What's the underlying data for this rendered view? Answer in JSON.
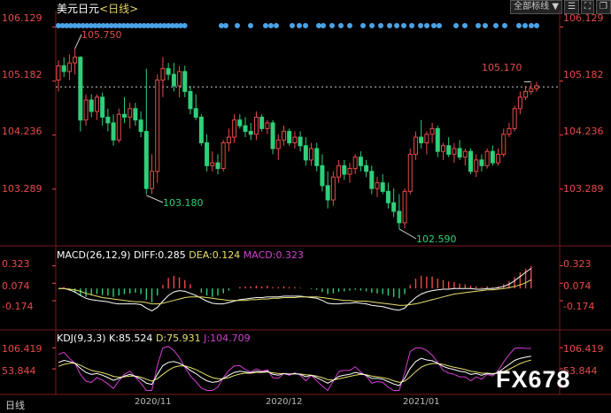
{
  "window": {
    "title": "美元日元",
    "period": "<日线>",
    "watermark": "FX678",
    "period_label": "日线"
  },
  "toolbar": {
    "all_label": "全部标线",
    "dropdown_icon": "triangle-down-icon",
    "icons": [
      "list-icon",
      "fullscreen-icon",
      "restore-icon"
    ]
  },
  "colors": {
    "up": "#e84a4a",
    "down": "#2ed07a",
    "dot": "#4aa3e8",
    "macd_diff": "#ffffff",
    "macd_dea": "#e8e06b",
    "kdj_k": "#ffffff",
    "kdj_d": "#e8e06b",
    "kdj_j": "#d43fd4"
  },
  "chart_data": [
    {
      "type": "candlestick",
      "title": "美元日元<日线>",
      "y_ticks": [
        "106.129",
        "105.182",
        "104.236",
        "103.289"
      ],
      "ylim": [
        102.45,
        106.2
      ],
      "x_ticks": [
        "2020/11",
        "2020/12",
        "2021/01"
      ],
      "annotations": [
        {
          "label": "105.750",
          "value": 105.75,
          "kind": "high"
        },
        {
          "label": "103.180",
          "value": 103.18,
          "kind": "low"
        },
        {
          "label": "102.590",
          "value": 102.59,
          "kind": "low"
        },
        {
          "label": "105.170",
          "value": 105.17,
          "kind": "high"
        }
      ],
      "last_price": 105.08,
      "ohlc": [
        [
          105.2,
          105.55,
          105.0,
          105.45
        ],
        [
          105.45,
          105.6,
          105.25,
          105.35
        ],
        [
          105.35,
          105.65,
          105.2,
          105.5
        ],
        [
          105.5,
          105.75,
          105.3,
          105.6
        ],
        [
          105.6,
          105.62,
          104.3,
          104.5
        ],
        [
          104.5,
          104.95,
          104.4,
          104.85
        ],
        [
          104.85,
          104.95,
          104.55,
          104.65
        ],
        [
          104.65,
          104.95,
          104.5,
          104.9
        ],
        [
          104.9,
          104.98,
          104.4,
          104.55
        ],
        [
          104.55,
          104.7,
          104.3,
          104.45
        ],
        [
          104.45,
          104.6,
          104.05,
          104.15
        ],
        [
          104.15,
          104.7,
          104.1,
          104.6
        ],
        [
          104.6,
          104.9,
          104.45,
          104.55
        ],
        [
          104.55,
          104.8,
          104.35,
          104.7
        ],
        [
          104.7,
          104.8,
          104.4,
          104.5
        ],
        [
          104.5,
          104.65,
          104.2,
          104.3
        ],
        [
          104.3,
          105.4,
          103.2,
          103.3
        ],
        [
          103.3,
          103.9,
          103.2,
          103.6
        ],
        [
          103.6,
          105.3,
          103.4,
          105.2
        ],
        [
          105.2,
          105.6,
          104.9,
          105.4
        ],
        [
          105.4,
          105.5,
          105.2,
          105.3
        ],
        [
          105.3,
          105.5,
          105.0,
          105.1
        ],
        [
          105.1,
          105.45,
          104.9,
          105.35
        ],
        [
          105.35,
          105.45,
          104.9,
          105.0
        ],
        [
          105.0,
          105.1,
          104.6,
          104.7
        ],
        [
          104.7,
          104.95,
          104.5,
          104.55
        ],
        [
          104.55,
          104.6,
          104.05,
          104.1
        ],
        [
          104.1,
          104.25,
          103.6,
          103.7
        ],
        [
          103.7,
          103.95,
          103.6,
          103.75
        ],
        [
          103.75,
          103.9,
          103.55,
          103.65
        ],
        [
          103.65,
          104.15,
          103.6,
          104.1
        ],
        [
          104.1,
          104.35,
          103.95,
          104.2
        ],
        [
          104.2,
          104.6,
          104.1,
          104.5
        ],
        [
          104.5,
          104.6,
          104.35,
          104.4
        ],
        [
          104.4,
          104.55,
          104.2,
          104.3
        ],
        [
          104.3,
          104.45,
          104.15,
          104.25
        ],
        [
          104.25,
          104.65,
          104.15,
          104.55
        ],
        [
          104.55,
          104.6,
          104.3,
          104.35
        ],
        [
          104.35,
          104.5,
          104.25,
          104.45
        ],
        [
          104.45,
          104.5,
          103.9,
          104.0
        ],
        [
          104.0,
          104.25,
          103.8,
          104.15
        ],
        [
          104.15,
          104.4,
          104.05,
          104.3
        ],
        [
          104.3,
          104.35,
          104.05,
          104.1
        ],
        [
          104.1,
          104.3,
          104.0,
          104.2
        ],
        [
          104.2,
          104.3,
          103.95,
          104.05
        ],
        [
          104.05,
          104.2,
          103.7,
          103.8
        ],
        [
          103.8,
          104.1,
          103.7,
          104.0
        ],
        [
          104.0,
          104.1,
          103.6,
          103.7
        ],
        [
          103.7,
          103.9,
          103.25,
          103.35
        ],
        [
          103.35,
          103.6,
          102.95,
          103.1
        ],
        [
          103.1,
          103.6,
          103.0,
          103.5
        ],
        [
          103.5,
          103.8,
          103.4,
          103.7
        ],
        [
          103.7,
          103.8,
          103.45,
          103.55
        ],
        [
          103.55,
          103.75,
          103.4,
          103.65
        ],
        [
          103.65,
          103.9,
          103.55,
          103.85
        ],
        [
          103.85,
          103.95,
          103.6,
          103.7
        ],
        [
          103.7,
          103.8,
          103.5,
          103.6
        ],
        [
          103.6,
          103.7,
          103.2,
          103.3
        ],
        [
          103.3,
          103.5,
          103.15,
          103.4
        ],
        [
          103.4,
          103.55,
          103.2,
          103.25
        ],
        [
          103.25,
          103.4,
          102.95,
          103.05
        ],
        [
          103.05,
          103.3,
          102.8,
          102.9
        ],
        [
          102.9,
          103.2,
          102.59,
          102.7
        ],
        [
          102.7,
          103.3,
          102.6,
          103.25
        ],
        [
          103.25,
          104.0,
          103.2,
          103.9
        ],
        [
          103.9,
          104.3,
          103.8,
          104.2
        ],
        [
          104.2,
          104.5,
          104.0,
          104.1
        ],
        [
          104.1,
          104.3,
          103.9,
          104.25
        ],
        [
          104.25,
          104.45,
          104.1,
          104.35
        ],
        [
          104.35,
          104.4,
          103.85,
          103.95
        ],
        [
          103.95,
          104.1,
          103.8,
          104.05
        ],
        [
          104.05,
          104.2,
          103.85,
          103.9
        ],
        [
          103.9,
          104.1,
          103.75,
          104.0
        ],
        [
          104.0,
          104.15,
          103.8,
          103.85
        ],
        [
          103.85,
          104.0,
          103.7,
          103.95
        ],
        [
          103.95,
          104.0,
          103.55,
          103.6
        ],
        [
          103.6,
          103.9,
          103.5,
          103.8
        ],
        [
          103.8,
          103.9,
          103.6,
          103.7
        ],
        [
          103.7,
          104.0,
          103.65,
          103.95
        ],
        [
          103.95,
          104.05,
          103.7,
          103.75
        ],
        [
          103.75,
          104.0,
          103.7,
          103.9
        ],
        [
          103.9,
          104.35,
          103.85,
          104.25
        ],
        [
          104.25,
          104.45,
          104.2,
          104.35
        ],
        [
          104.35,
          104.75,
          104.3,
          104.7
        ],
        [
          104.7,
          105.0,
          104.6,
          104.9
        ],
        [
          104.9,
          105.1,
          104.85,
          105.0
        ],
        [
          105.0,
          105.15,
          104.95,
          105.05
        ],
        [
          105.05,
          105.17,
          105.0,
          105.1
        ]
      ]
    },
    {
      "type": "bar",
      "title": "MACD(26,12,9)",
      "legend": [
        {
          "name": "DIFF",
          "value": "0.285"
        },
        {
          "name": "DEA",
          "value": "0.124"
        },
        {
          "name": "MACD",
          "value": "0.323"
        }
      ],
      "y_ticks": [
        "0.323",
        "0.074",
        "-0.174"
      ],
      "ylim": [
        -0.3,
        0.38
      ],
      "series_note": "histogram = MACD",
      "histogram": [
        0.0,
        0.02,
        -0.03,
        -0.06,
        -0.1,
        -0.12,
        -0.1,
        -0.08,
        -0.09,
        -0.1,
        -0.12,
        -0.1,
        -0.08,
        -0.07,
        -0.06,
        -0.08,
        -0.16,
        -0.2,
        -0.1,
        0.05,
        0.15,
        0.18,
        0.16,
        0.12,
        0.06,
        0.0,
        -0.06,
        -0.1,
        -0.12,
        -0.1,
        -0.07,
        -0.03,
        0.0,
        0.02,
        0.03,
        0.03,
        0.04,
        0.03,
        0.04,
        0.02,
        0.02,
        0.03,
        0.02,
        0.02,
        0.01,
        0.0,
        -0.01,
        -0.02,
        -0.05,
        -0.08,
        -0.07,
        -0.05,
        -0.04,
        -0.03,
        -0.02,
        -0.03,
        -0.04,
        -0.06,
        -0.07,
        -0.08,
        -0.1,
        -0.12,
        -0.14,
        -0.08,
        0.05,
        0.14,
        0.18,
        0.17,
        0.17,
        0.14,
        0.12,
        0.1,
        0.09,
        0.07,
        0.06,
        0.04,
        0.03,
        0.02,
        0.03,
        0.02,
        0.03,
        0.06,
        0.1,
        0.16,
        0.23,
        0.28,
        0.32
      ],
      "diff": [
        0.0,
        0.0,
        -0.02,
        -0.05,
        -0.1,
        -0.14,
        -0.16,
        -0.17,
        -0.18,
        -0.19,
        -0.21,
        -0.22,
        -0.22,
        -0.22,
        -0.22,
        -0.23,
        -0.28,
        -0.32,
        -0.27,
        -0.18,
        -0.1,
        -0.05,
        -0.03,
        -0.04,
        -0.07,
        -0.1,
        -0.14,
        -0.18,
        -0.21,
        -0.22,
        -0.22,
        -0.2,
        -0.18,
        -0.16,
        -0.15,
        -0.14,
        -0.13,
        -0.13,
        -0.12,
        -0.12,
        -0.12,
        -0.11,
        -0.11,
        -0.11,
        -0.11,
        -0.12,
        -0.13,
        -0.14,
        -0.17,
        -0.21,
        -0.22,
        -0.22,
        -0.21,
        -0.21,
        -0.2,
        -0.21,
        -0.22,
        -0.24,
        -0.25,
        -0.26,
        -0.28,
        -0.3,
        -0.31,
        -0.28,
        -0.2,
        -0.13,
        -0.08,
        -0.05,
        -0.03,
        -0.02,
        -0.01,
        -0.01,
        0.0,
        0.0,
        0.0,
        0.0,
        -0.01,
        -0.01,
        0.0,
        0.0,
        0.01,
        0.03,
        0.06,
        0.11,
        0.17,
        0.23,
        0.285
      ],
      "dea": [
        0.0,
        0.0,
        -0.01,
        -0.02,
        -0.04,
        -0.07,
        -0.09,
        -0.11,
        -0.13,
        -0.14,
        -0.15,
        -0.16,
        -0.17,
        -0.18,
        -0.19,
        -0.19,
        -0.2,
        -0.22,
        -0.22,
        -0.21,
        -0.19,
        -0.17,
        -0.15,
        -0.13,
        -0.12,
        -0.12,
        -0.12,
        -0.13,
        -0.14,
        -0.15,
        -0.16,
        -0.17,
        -0.17,
        -0.17,
        -0.17,
        -0.16,
        -0.16,
        -0.15,
        -0.15,
        -0.14,
        -0.14,
        -0.13,
        -0.13,
        -0.13,
        -0.12,
        -0.12,
        -0.12,
        -0.12,
        -0.13,
        -0.14,
        -0.15,
        -0.16,
        -0.17,
        -0.17,
        -0.18,
        -0.18,
        -0.18,
        -0.19,
        -0.2,
        -0.21,
        -0.22,
        -0.23,
        -0.24,
        -0.24,
        -0.23,
        -0.22,
        -0.2,
        -0.18,
        -0.16,
        -0.14,
        -0.12,
        -0.1,
        -0.08,
        -0.07,
        -0.06,
        -0.05,
        -0.04,
        -0.03,
        -0.02,
        -0.02,
        -0.01,
        0.0,
        0.01,
        0.03,
        0.05,
        0.08,
        0.124
      ]
    },
    {
      "type": "line",
      "title": "KDJ(9,3,3)",
      "legend": [
        {
          "name": "K",
          "value": "85.524"
        },
        {
          "name": "D",
          "value": "75.931"
        },
        {
          "name": "J",
          "value": "104.709"
        }
      ],
      "y_ticks": [
        "106.419",
        "53.844"
      ],
      "ylim": [
        -10,
        118
      ],
      "k": [
        70,
        75,
        72,
        68,
        55,
        45,
        40,
        42,
        38,
        32,
        25,
        30,
        36,
        40,
        35,
        28,
        18,
        15,
        40,
        62,
        70,
        72,
        68,
        60,
        50,
        42,
        32,
        24,
        20,
        22,
        30,
        38,
        45,
        48,
        46,
        44,
        48,
        46,
        48,
        40,
        38,
        42,
        40,
        42,
        40,
        34,
        38,
        32,
        25,
        18,
        25,
        35,
        38,
        40,
        45,
        42,
        38,
        30,
        30,
        28,
        22,
        16,
        12,
        30,
        55,
        72,
        80,
        76,
        74,
        68,
        60,
        55,
        52,
        48,
        46,
        40,
        42,
        38,
        42,
        40,
        45,
        55,
        65,
        75,
        80,
        83,
        85.5
      ],
      "d": [
        60,
        65,
        68,
        68,
        63,
        56,
        50,
        47,
        44,
        40,
        35,
        33,
        34,
        36,
        36,
        33,
        28,
        23,
        29,
        40,
        50,
        58,
        61,
        61,
        57,
        52,
        45,
        38,
        32,
        29,
        29,
        32,
        37,
        41,
        43,
        43,
        45,
        45,
        46,
        44,
        42,
        42,
        41,
        41,
        41,
        39,
        38,
        36,
        32,
        27,
        26,
        29,
        32,
        35,
        38,
        40,
        39,
        36,
        34,
        32,
        29,
        24,
        20,
        23,
        34,
        47,
        58,
        64,
        67,
        67,
        65,
        61,
        58,
        55,
        52,
        48,
        46,
        43,
        43,
        42,
        43,
        47,
        53,
        60,
        67,
        72,
        75.9
      ],
      "j": [
        90,
        95,
        80,
        68,
        40,
        23,
        20,
        32,
        26,
        16,
        5,
        24,
        40,
        48,
        33,
        18,
        0,
        0,
        62,
        106,
        110,
        100,
        82,
        58,
        36,
        22,
        6,
        0,
        0,
        8,
        32,
        50,
        61,
        62,
        52,
        46,
        54,
        48,
        52,
        32,
        30,
        42,
        38,
        44,
        38,
        24,
        38,
        24,
        11,
        0,
        23,
        47,
        50,
        50,
        59,
        46,
        36,
        18,
        22,
        20,
        8,
        0,
        0,
        44,
        97,
        106,
        106,
        100,
        88,
        70,
        50,
        43,
        40,
        34,
        34,
        24,
        34,
        28,
        40,
        36,
        49,
        71,
        89,
        105,
        106,
        105,
        104.7
      ]
    }
  ]
}
